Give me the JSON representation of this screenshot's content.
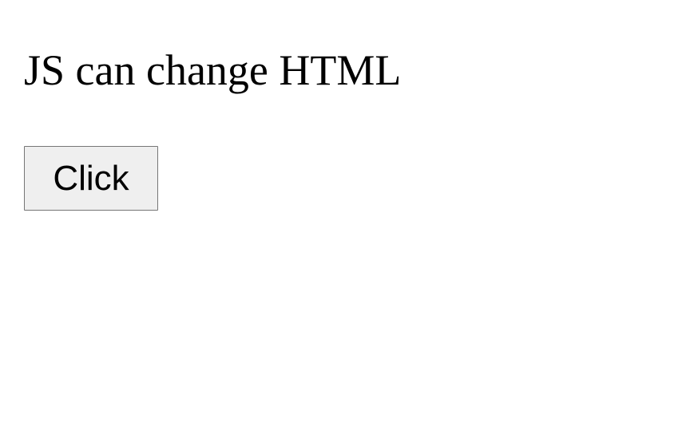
{
  "content": {
    "heading": "JS can change HTML",
    "button_label": "Click"
  }
}
